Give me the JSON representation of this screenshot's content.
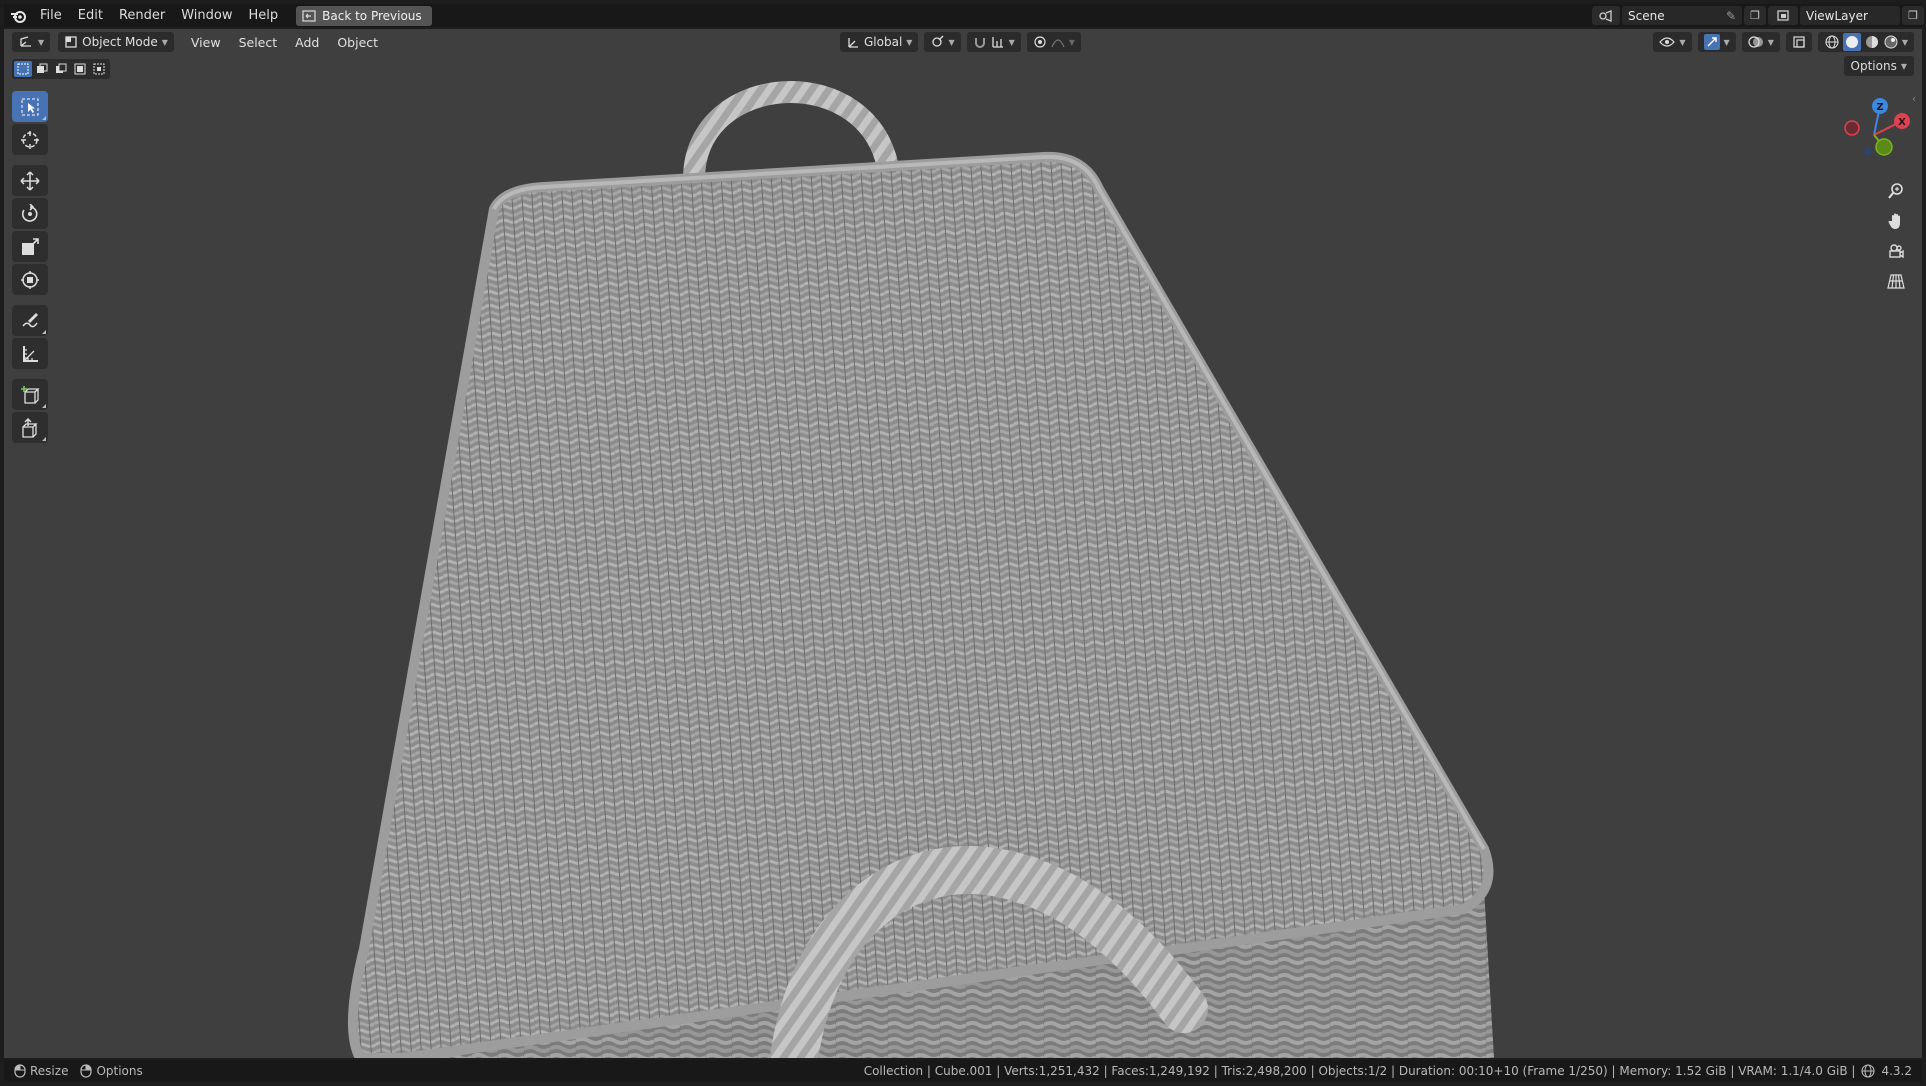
{
  "topbar": {
    "menus": [
      "File",
      "Edit",
      "Render",
      "Window",
      "Help"
    ],
    "back_button": "Back to Previous",
    "scene_name": "Scene",
    "view_layer_name": "ViewLayer"
  },
  "header": {
    "mode": "Object Mode",
    "menus": [
      "View",
      "Select",
      "Add",
      "Object"
    ],
    "transform_orientation": "Global",
    "options_label": "Options"
  },
  "toolbar": {
    "tools": [
      "select-box",
      "cursor",
      "move",
      "rotate",
      "scale",
      "transform",
      "annotate",
      "measure",
      "add-cube",
      "extrude"
    ],
    "active_tool": "select-box"
  },
  "gizmo": {
    "z_label": "Z",
    "x_label": "X"
  },
  "statusbar": {
    "left_items": [
      "Resize",
      "Options"
    ],
    "stats": "Collection | Cube.001 | Verts:1,251,432 | Faces:1,249,192 | Tris:2,498,200 | Objects:1/2 | Duration: 00:10+10 (Frame 1/250) | Memory: 1.52 GiB | VRAM: 1.1/4.0 GiB |",
    "version": "4.3.2"
  },
  "colors": {
    "accent": "#4772b3",
    "viewport_bg": "#3f3f3f",
    "axis_x": "#e04050",
    "axis_y": "#7ab320",
    "axis_z": "#3d89e0"
  }
}
